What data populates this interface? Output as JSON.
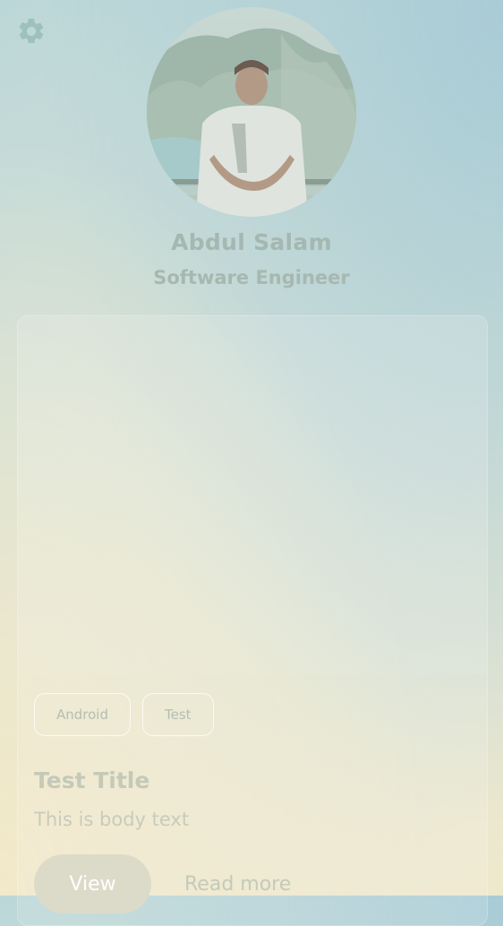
{
  "header": {
    "settings_icon": "gear-icon",
    "avatar_image": "profile-photo"
  },
  "profile": {
    "name": "Abdul Salam",
    "role": "Software Engineer"
  },
  "card": {
    "tags": [
      "Android",
      "Test"
    ],
    "title": "Test Title",
    "body": "This is body text",
    "primary_action": "View",
    "secondary_action": "Read more"
  },
  "colors": {
    "gear": "#a9c7c2",
    "text_muted": "#a5b7b1",
    "button_fill": "#dcdbca",
    "background_top_right": "#a9ccd6",
    "background_bottom_left": "#f2e9c9"
  }
}
